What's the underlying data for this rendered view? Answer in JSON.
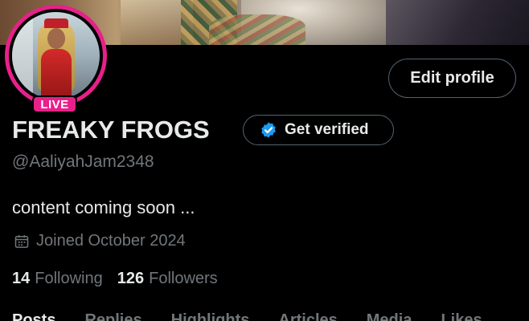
{
  "profile": {
    "display_name": "FREAKY FROGS",
    "handle": "@AaliyahJam2348",
    "bio": "content coming soon ...",
    "joined": "Joined October 2024",
    "live_badge": "LIVE"
  },
  "actions": {
    "edit_profile_label": "Edit profile",
    "get_verified_label": "Get verified"
  },
  "stats": {
    "following_count": "14",
    "following_label": "Following",
    "followers_count": "126",
    "followers_label": "Followers"
  },
  "tabs": [
    {
      "label": "Posts"
    },
    {
      "label": "Replies"
    },
    {
      "label": "Highlights"
    },
    {
      "label": "Articles"
    },
    {
      "label": "Media"
    },
    {
      "label": "Likes"
    }
  ],
  "icons": {
    "verified": "verified-badge-icon",
    "calendar": "calendar-icon"
  },
  "colors": {
    "background": "#000000",
    "live_ring": "#e8208a",
    "verified_blue": "#1d9bf0",
    "secondary_text": "#71767b",
    "primary_text": "#e7e9ea",
    "button_border": "#536471"
  }
}
